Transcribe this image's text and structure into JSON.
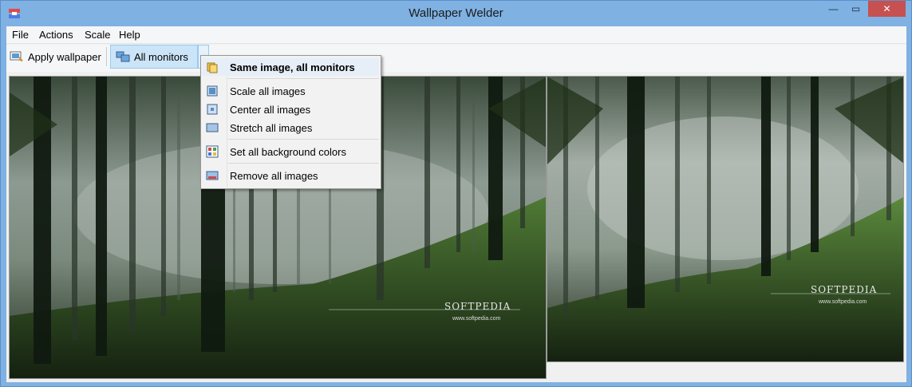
{
  "window": {
    "title": "Wallpaper Welder",
    "minimize_glyph": "—",
    "maximize_glyph": "▭",
    "close_glyph": "✕"
  },
  "menubar": {
    "items": [
      "File",
      "Actions",
      "Scale",
      "Help"
    ]
  },
  "toolbar": {
    "apply_label": "Apply wallpaper",
    "monitors_label": "All monitors",
    "dropdown_glyph": "▾",
    "apply_icon": "wallpaper-apply-icon",
    "monitors_icon": "monitors-icon"
  },
  "context_menu": {
    "items": [
      {
        "label": "Same image, all monitors",
        "icon": "same-image-icon",
        "bold": true
      },
      {
        "label": "Scale all images",
        "icon": "scale-icon"
      },
      {
        "label": "Center all images",
        "icon": "center-icon"
      },
      {
        "label": "Stretch all images",
        "icon": "stretch-icon"
      },
      {
        "label": "Set all background colors",
        "icon": "palette-icon"
      },
      {
        "label": "Remove all images",
        "icon": "remove-image-icon"
      }
    ]
  },
  "monitors": {
    "m1_watermark": "SOFTPEDIA",
    "m1_watermark_sub": "www.softpedia.com",
    "m2_watermark": "SOFTPEDIA",
    "m2_watermark_sub": "www.softpedia.com"
  },
  "colors": {
    "titlebar": "#7fb1e2",
    "close_button": "#c75050",
    "selected_toolbar": "#cce4f7",
    "forest_dark": "#1b2618",
    "forest_mist": "#a9b3ab",
    "forest_green": "#3f6a2c"
  }
}
